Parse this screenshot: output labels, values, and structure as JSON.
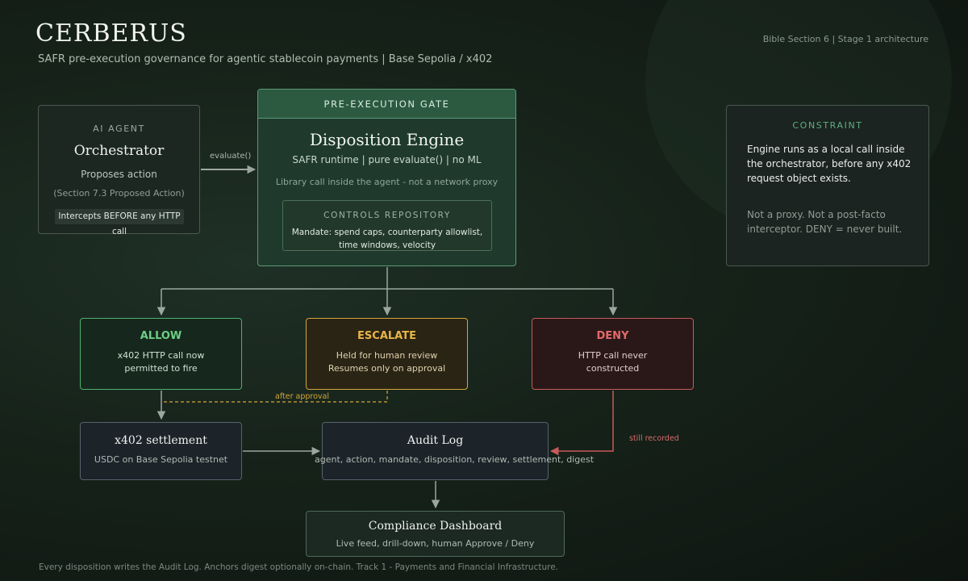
{
  "header": {
    "title": "CERBERUS",
    "subtitle": "SAFR pre-execution governance for agentic stablecoin payments  |  Base Sepolia / x402",
    "section_ref": "Bible Section 6 | Stage 1 architecture"
  },
  "agent": {
    "caption": "AI AGENT",
    "title": "Orchestrator",
    "line1": "Proposes action",
    "line2": "(Section 7.3 Proposed Action)",
    "badge": "Intercepts BEFORE any HTTP call"
  },
  "edge_evaluate": "evaluate()",
  "gate": {
    "header": "PRE-EXECUTION GATE",
    "title": "Disposition Engine",
    "line1": "SAFR runtime | pure evaluate() | no ML",
    "line2": "Library call inside the agent - not a network proxy",
    "controls": {
      "caption": "CONTROLS REPOSITORY",
      "text": "Mandate: spend caps, counterparty allowlist, time windows, velocity"
    }
  },
  "constraint": {
    "caption": "CONSTRAINT",
    "para1": "Engine runs as a local call inside the orchestrator, before any x402 request object exists.",
    "para2": "Not a proxy. Not a post-facto interceptor. DENY = never built."
  },
  "decisions": {
    "allow": {
      "title": "ALLOW",
      "line1": "x402 HTTP call now",
      "line2": "permitted to fire"
    },
    "escalate": {
      "title": "ESCALATE",
      "line1": "Held for human review",
      "line2": "Resumes only on approval"
    },
    "deny": {
      "title": "DENY",
      "line1": "HTTP call never",
      "line2": "constructed"
    }
  },
  "edge_after_approval": "after approval",
  "edge_still_recorded": "still recorded",
  "settlement": {
    "title": "x402 settlement",
    "line": "USDC on Base Sepolia testnet"
  },
  "audit": {
    "title": "Audit Log",
    "line": "agent, action, mandate, disposition, review, settlement, digest"
  },
  "dashboard": {
    "title": "Compliance Dashboard",
    "line": "Live feed, drill-down, human Approve / Deny"
  },
  "footer": "Every disposition writes the Audit Log. Anchors digest optionally on-chain. Track 1 - Payments and Financial Infrastructure.",
  "colors": {
    "allow": "#4db36d",
    "escalate": "#d4a63a",
    "deny": "#c85a5a",
    "gate": "#5b9a75",
    "wire": "#9aa7a0"
  }
}
